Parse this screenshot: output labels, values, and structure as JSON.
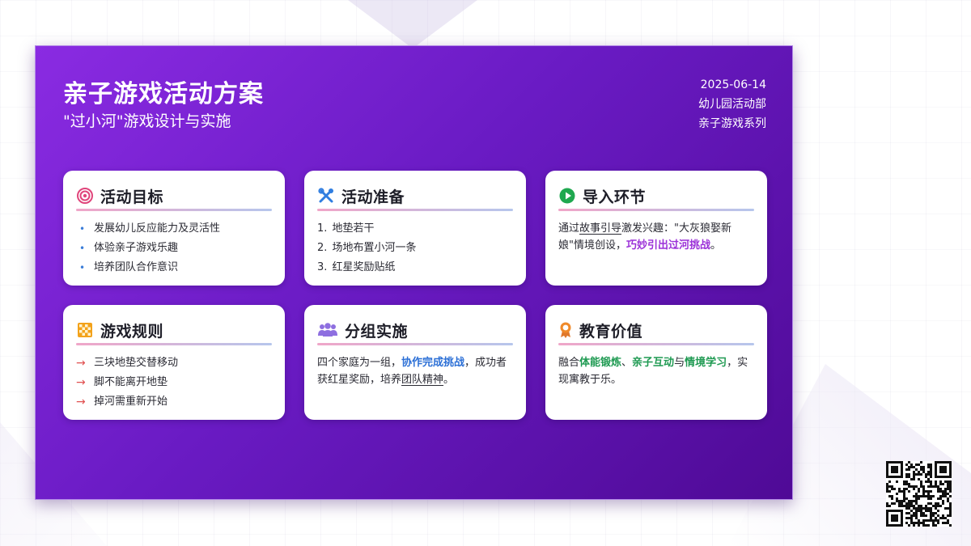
{
  "colors": {
    "slide_start": "#8a2be2",
    "slide_end": "#4f0a96",
    "accent_purple": "#9b30d8",
    "accent_blue": "#2b6fd6",
    "accent_green": "#1f9a52",
    "arrow_red": "#e05050"
  },
  "header": {
    "title": "亲子游戏活动方案",
    "subtitle": "\"过小河\"游戏设计与实施",
    "date": "2025-06-14",
    "department": "幼儿园活动部",
    "series": "亲子游戏系列"
  },
  "cards": {
    "goals": {
      "icon": "target-icon",
      "title": "活动目标",
      "items": [
        "发展幼儿反应能力及灵活性",
        "体验亲子游戏乐趣",
        "培养团队合作意识"
      ]
    },
    "prep": {
      "icon": "tools-icon",
      "title": "活动准备",
      "items": [
        "地垫若干",
        "场地布置小河一条",
        "红星奖励贴纸"
      ],
      "numbers": [
        "1.",
        "2.",
        "3."
      ]
    },
    "intro": {
      "icon": "play-icon",
      "title": "导入环节",
      "p1": "通过",
      "u1": "故事引导",
      "p2": "激发兴趣：\"大灰狼娶新娘\"情境创设，",
      "h1": "巧妙引出过河挑战",
      "p3": "。"
    },
    "rules": {
      "icon": "checker-icon",
      "title": "游戏规则",
      "items": [
        "三块地垫交替移动",
        "脚不能离开地垫",
        "掉河需重新开始"
      ]
    },
    "groups": {
      "icon": "group-icon",
      "title": "分组实施",
      "p1": "四个家庭为一组，",
      "h1": "协作完成挑战",
      "p2": "，成功者获红星奖励，培养",
      "u1": "团队精神",
      "p3": "。"
    },
    "value": {
      "icon": "medal-icon",
      "title": "教育价值",
      "p1": "融合",
      "h1": "体能锻炼",
      "p2": "、",
      "h2": "亲子互动",
      "p3": "与",
      "h3": "情境学习",
      "p4": "，实现寓教于乐。"
    }
  },
  "qr": {
    "icon": "qr-code-icon"
  }
}
